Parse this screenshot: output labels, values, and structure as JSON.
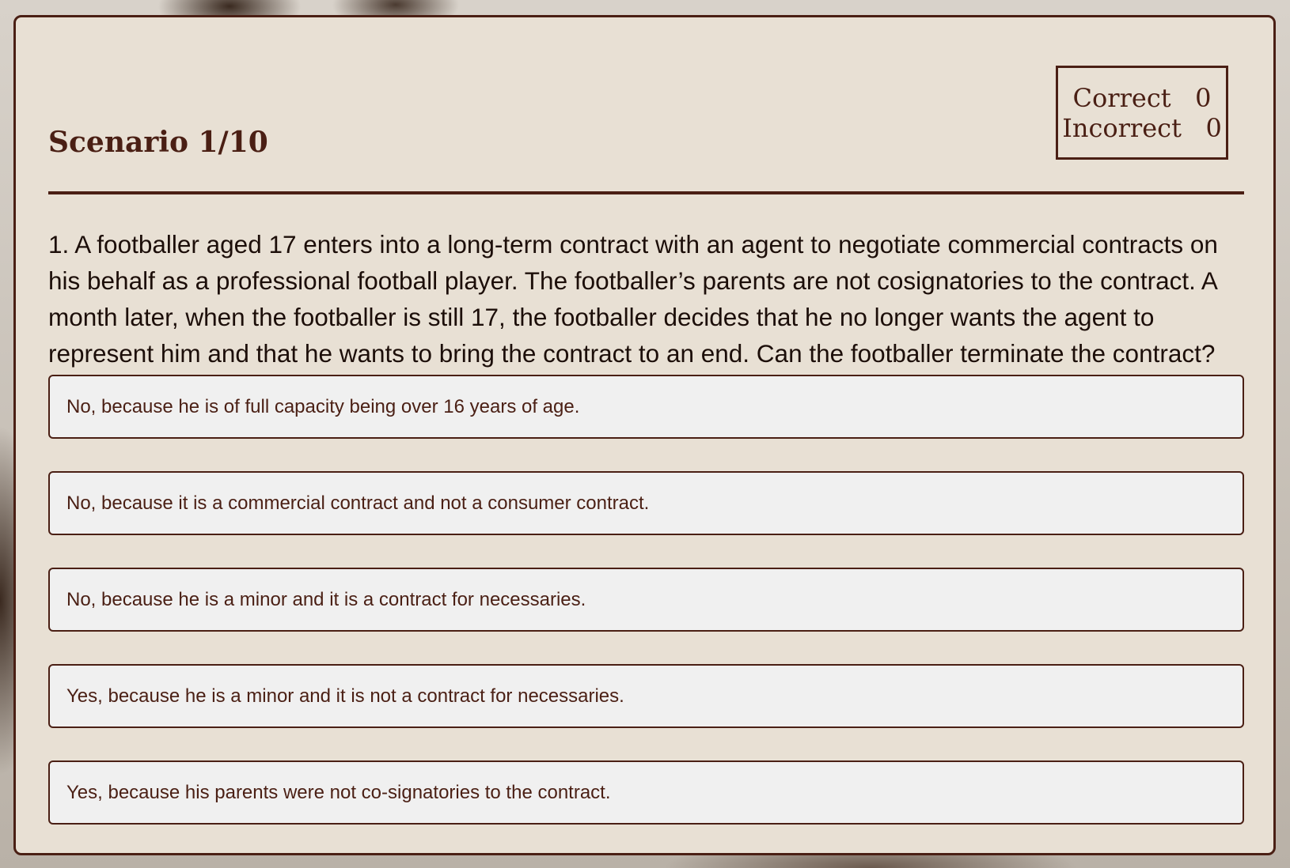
{
  "quiz": {
    "title": "Scenario 1/10",
    "score": {
      "correct_label": "Correct",
      "correct_value": "0",
      "incorrect_label": "Incorrect",
      "incorrect_value": "0"
    },
    "question": "1. A footballer aged 17 enters into a long-term contract with an agent to negotiate commercial contracts on his behalf as a professional football player. The footballer’s parents are not cosignatories to the contract. A month later, when the footballer is still 17, the footballer decides that he no longer wants the agent to represent him and that he wants to bring the contract to an end. Can the footballer terminate the contract?",
    "options": [
      {
        "label": "No, because he is of full capacity being over 16 years of age."
      },
      {
        "label": "No, because it is a commercial contract and not a consumer contract."
      },
      {
        "label": "No, because he is a minor and it is a contract for necessaries."
      },
      {
        "label": "Yes, because he is a minor and it is not a contract for necessaries."
      },
      {
        "label": "Yes, because his parents were not co-signatories to the contract."
      }
    ]
  },
  "colors": {
    "accent": "#4a1f14",
    "panel_background": "#e8e0d4",
    "option_background": "#f0f0f0"
  }
}
